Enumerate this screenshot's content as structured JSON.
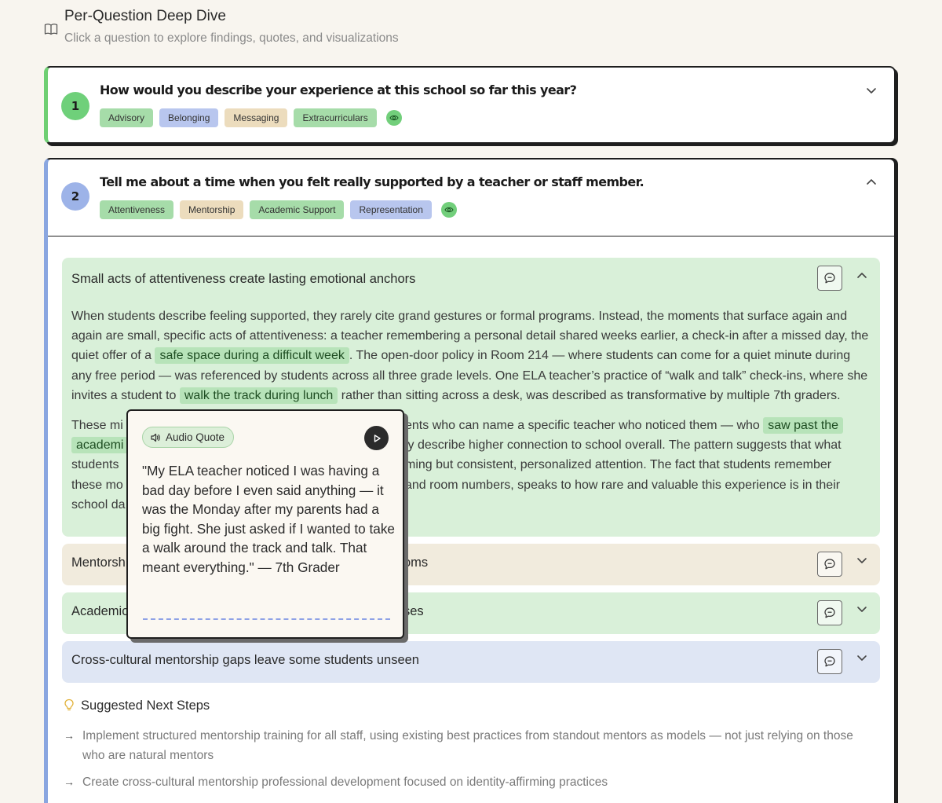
{
  "header": {
    "title": "Per-Question Deep Dive",
    "subtitle": "Click a question to explore findings, quotes, and visualizations",
    "icon": "book-icon"
  },
  "questions": [
    {
      "number": "1",
      "title": "How would you describe your experience at this school so far this year?",
      "expanded": false,
      "tags": [
        {
          "label": "Advisory",
          "color": "#a6dca9"
        },
        {
          "label": "Belonging",
          "color": "#b8c6ee"
        },
        {
          "label": "Messaging",
          "color": "#ecdcbd"
        },
        {
          "label": "Extracurriculars",
          "color": "#a6dca9"
        }
      ]
    },
    {
      "number": "2",
      "title": "Tell me about a time when you felt really supported by a teacher or staff member.",
      "expanded": true,
      "tags": [
        {
          "label": "Attentiveness",
          "color": "#a6dca9"
        },
        {
          "label": "Mentorship",
          "color": "#ecdcbd"
        },
        {
          "label": "Academic Support",
          "color": "#a6dca9"
        },
        {
          "label": "Representation",
          "color": "#b8c6ee"
        }
      ],
      "findings": [
        {
          "title": "Small acts of attentiveness create lasting emotional anchors",
          "expanded": true,
          "paragraph1": {
            "t1": "When students describe feeling supported, they rarely cite grand gestures or formal programs. Instead, the moments that surface again and again are small, specific acts of attentiveness: a teacher remembering a personal detail shared weeks earlier, a check-in after a missed day, the quiet offer of a ",
            "h1": "safe space during a difficult week",
            "t2": ". The open-door policy in Room 214 — where students can come for a quiet minute during any free period — was referenced by students across all three grade levels. One ELA teacher’s practice of “walk and talk” check-ins, where she invites a student to ",
            "h2": "walk the track during lunch",
            "t3": " rather than sitting across a desk, was described as transformative by multiple 7th graders."
          },
          "paragraph2": {
            "t1": "These mi",
            "gap": "",
            "t2": "ents who can name a specific teacher who noticed them — who ",
            "h1": "saw past the",
            "h2": "academi",
            "t3": "ly describe higher connection to school overall. The pattern suggests that what",
            "line3a": "students ",
            "line3b": "ming but consistent, personalized attention. The fact that students remember",
            "line4a": "these mo",
            "line4b": "and room numbers, speaks to how rare and valuable this experience is in their",
            "line5": "school da"
          }
        },
        {
          "title_left": "Mentorsh",
          "title_right": "oms",
          "color": "#f1ebdd"
        },
        {
          "title_left": "Academic",
          "title_right": "ses",
          "color": "#d9f0d9"
        },
        {
          "title": "Cross-cultural mentorship gaps leave some students unseen",
          "color": "#dfe6f4"
        }
      ]
    }
  ],
  "popup": {
    "badge": "Audio Quote",
    "quote": "\"My ELA teacher noticed I was having a bad day before I even said anything — it was the Monday after my parents had a big fight. She just asked if I wanted to take a walk around the track and talk. That meant everything.\" — 7th Grader"
  },
  "next_steps": {
    "title": "Suggested Next Steps",
    "items": [
      "Implement structured mentorship training for all staff, using existing best practices from standout mentors as models — not just relying on those who are natural mentors",
      "Create cross-cultural mentorship professional development focused on identity-affirming practices"
    ]
  }
}
